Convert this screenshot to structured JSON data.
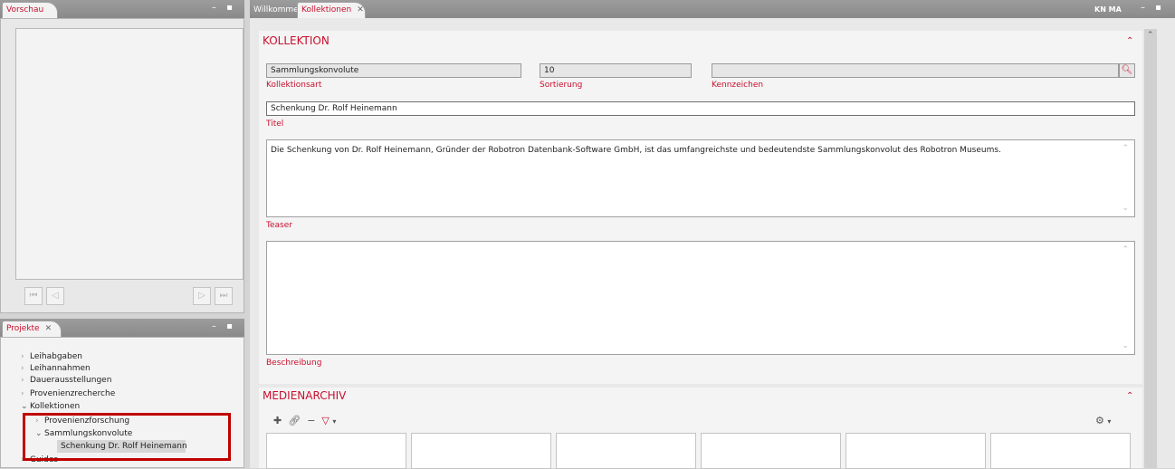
{
  "preview_panel": {
    "title": "Vorschau"
  },
  "projects_panel": {
    "title": "Projekte",
    "tree": [
      {
        "label": "Leihabgaben",
        "chevron": "›"
      },
      {
        "label": "Leihannahmen",
        "chevron": "›"
      },
      {
        "label": "Dauerausstellungen",
        "chevron": "›"
      },
      {
        "label": "Provenienzrecherche",
        "chevron": "›"
      },
      {
        "label": "Kollektionen",
        "chevron": "⌄"
      },
      {
        "label": "Provenienzforschung",
        "chevron": "›"
      },
      {
        "label": "Sammlungskonvolute",
        "chevron": "⌄"
      },
      {
        "label": "Schenkung Dr. Rolf Heinemann",
        "chevron": ""
      },
      {
        "label": "Guides",
        "chevron": "›"
      }
    ]
  },
  "editor": {
    "tabs": {
      "welcome": "Willkommen",
      "active": "Kollektionen"
    },
    "user_initials": "KN  MA",
    "kollektion": {
      "header": "KOLLEKTION",
      "kollektionsart_value": "Sammlungskonvolute",
      "kollektionsart_label": "Kollektionsart",
      "sortierung_value": "10",
      "sortierung_label": "Sortierung",
      "kennzeichen_value": "",
      "kennzeichen_label": "Kennzeichen",
      "titel_value": "Schenkung Dr. Rolf Heinemann",
      "titel_label": "Titel",
      "teaser_value": "Die Schenkung von Dr. Rolf Heinemann, Gründer der Robotron Datenbank-Software GmbH, ist das umfangreichste und bedeutendste Sammlungskonvolut des Robotron Museums.",
      "teaser_label": "Teaser",
      "beschreibung_value": "",
      "beschreibung_label": "Beschreibung"
    },
    "medienarchiv": {
      "header": "MEDIENARCHIV"
    }
  },
  "colors": {
    "accent": "#c8102e",
    "highlight_border": "#c00000"
  }
}
